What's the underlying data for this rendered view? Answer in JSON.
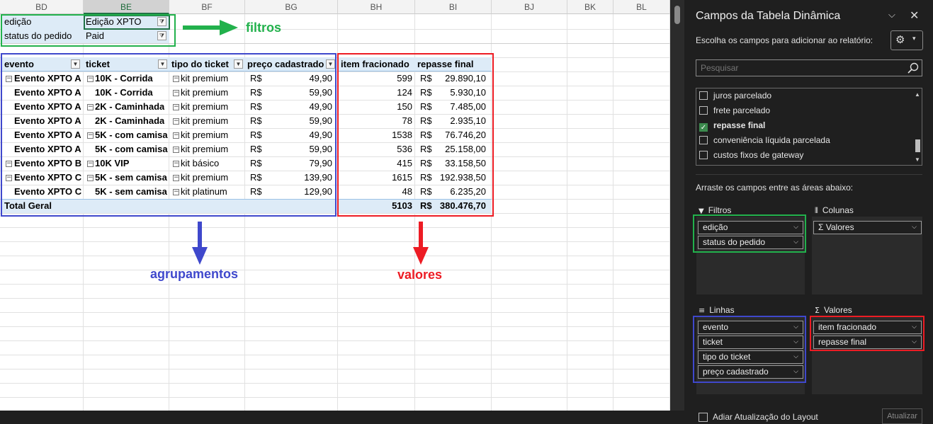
{
  "sheet": {
    "columns": [
      "BD",
      "BE",
      "BF",
      "BG",
      "BH",
      "BI",
      "BJ",
      "BK",
      "BL"
    ],
    "filters": [
      {
        "label": "edição",
        "value": "Edição XPTO"
      },
      {
        "label": "status do pedido",
        "value": "Paid"
      }
    ],
    "headers": {
      "evento": "evento",
      "ticket": "ticket",
      "tipo": "tipo do ticket",
      "preco": "preço cadastrado",
      "item": "item fracionado",
      "repasse": "repasse final"
    },
    "rows": [
      {
        "evento": "Evento XPTO A",
        "ticket": "10K - Corrida",
        "tipo": "kit premium",
        "cur": "R$",
        "preco": "49,90",
        "item": "599",
        "cur2": "R$",
        "repasse": "29.890,10",
        "ev_minus": true,
        "tk_minus": true
      },
      {
        "evento": "Evento XPTO A",
        "ticket": "10K - Corrida",
        "tipo": "kit premium",
        "cur": "R$",
        "preco": "59,90",
        "item": "124",
        "cur2": "R$",
        "repasse": "5.930,10",
        "ev_minus": false,
        "tk_minus": false
      },
      {
        "evento": "Evento XPTO A",
        "ticket": "2K - Caminhada",
        "tipo": "kit premium",
        "cur": "R$",
        "preco": "49,90",
        "item": "150",
        "cur2": "R$",
        "repasse": "7.485,00",
        "ev_minus": false,
        "tk_minus": true
      },
      {
        "evento": "Evento XPTO A",
        "ticket": "2K - Caminhada",
        "tipo": "kit premium",
        "cur": "R$",
        "preco": "59,90",
        "item": "78",
        "cur2": "R$",
        "repasse": "2.935,10",
        "ev_minus": false,
        "tk_minus": false
      },
      {
        "evento": "Evento XPTO A",
        "ticket": "5K - com camisa",
        "tipo": "kit premium",
        "cur": "R$",
        "preco": "49,90",
        "item": "1538",
        "cur2": "R$",
        "repasse": "76.746,20",
        "ev_minus": false,
        "tk_minus": true
      },
      {
        "evento": "Evento XPTO A",
        "ticket": "5K - com camisa",
        "tipo": "kit premium",
        "cur": "R$",
        "preco": "59,90",
        "item": "536",
        "cur2": "R$",
        "repasse": "25.158,00",
        "ev_minus": false,
        "tk_minus": false
      },
      {
        "evento": "Evento XPTO B",
        "ticket": "10K VIP",
        "tipo": "kit básico",
        "cur": "R$",
        "preco": "79,90",
        "item": "415",
        "cur2": "R$",
        "repasse": "33.158,50",
        "ev_minus": true,
        "tk_minus": true
      },
      {
        "evento": "Evento XPTO C",
        "ticket": "5K - sem camisa",
        "tipo": "kit premium",
        "cur": "R$",
        "preco": "139,90",
        "item": "1615",
        "cur2": "R$",
        "repasse": "192.938,50",
        "ev_minus": true,
        "tk_minus": true
      },
      {
        "evento": "Evento XPTO C",
        "ticket": "5K - sem camisa",
        "tipo": "kit platinum",
        "cur": "R$",
        "preco": "129,90",
        "item": "48",
        "cur2": "R$",
        "repasse": "6.235,20",
        "ev_minus": false,
        "tk_minus": false
      }
    ],
    "total": {
      "label": "Total Geral",
      "item": "5103",
      "cur": "R$",
      "repasse": "380.476,70"
    },
    "annotations": {
      "filtros": "filtros",
      "agrupamentos": "agrupamentos",
      "valores": "valores"
    },
    "colors": {
      "green": "#22b14c",
      "blue": "#3f48cc",
      "red": "#ed1c24",
      "header_bg": "#ddebf7"
    }
  },
  "pane": {
    "title": "Campos da Tabela Dinâmica",
    "subtitle": "Escolha os campos para adicionar ao relatório:",
    "search_placeholder": "Pesquisar",
    "fields": [
      {
        "label": "juros parcelado",
        "checked": false
      },
      {
        "label": "frete parcelado",
        "checked": false
      },
      {
        "label": "repasse final",
        "checked": true
      },
      {
        "label": "conveniência líquida parcelada",
        "checked": false
      },
      {
        "label": "custos fixos de gateway",
        "checked": false
      }
    ],
    "drag_text": "Arraste os campos entre as áreas abaixo:",
    "areas": {
      "filtros": {
        "title": "Filtros",
        "items": [
          "edição",
          "status do pedido"
        ]
      },
      "colunas": {
        "title": "Colunas",
        "items": [
          "Valores"
        ]
      },
      "linhas": {
        "title": "Linhas",
        "items": [
          "evento",
          "ticket",
          "tipo do ticket",
          "preço cadastrado"
        ]
      },
      "valores": {
        "title": "Valores",
        "items": [
          "item fracionado",
          "repasse final"
        ]
      }
    },
    "defer_label": "Adiar Atualização do Layout",
    "update_label": "Atualizar"
  }
}
